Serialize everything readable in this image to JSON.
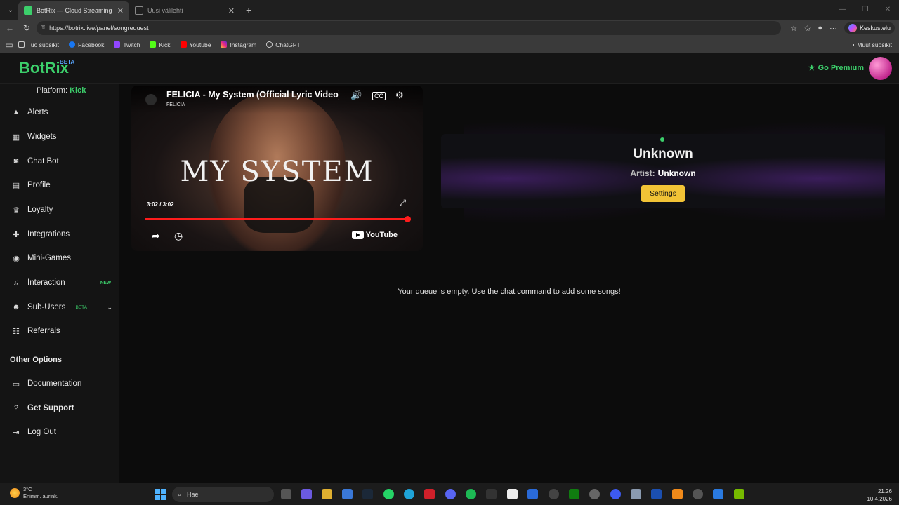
{
  "browser": {
    "tabs": [
      {
        "title": "BotRix — Cloud Streaming Bot for",
        "active": true
      },
      {
        "title": "Uusi välilehti",
        "active": false
      }
    ],
    "url": "https://botrix.live/panel/songrequest",
    "copilot_label": "Keskustelu",
    "bookmarks": [
      "Tuo suosikit",
      "Facebook",
      "Twitch",
      "Kick",
      "Youtube",
      "Instagram",
      "ChatGPT"
    ],
    "other_favorites": "Muut suosikit"
  },
  "header": {
    "logo": "BotRix",
    "logo_badge": "BETA",
    "premium_label": "Go Premium"
  },
  "sidebar": {
    "platform_label": "Platform:",
    "platform_value": "Kick",
    "items": [
      {
        "label": "Alerts",
        "icon": "warning-icon"
      },
      {
        "label": "Widgets",
        "icon": "grid-icon"
      },
      {
        "label": "Chat Bot",
        "icon": "robot-icon"
      },
      {
        "label": "Profile",
        "icon": "profile-icon"
      },
      {
        "label": "Loyalty",
        "icon": "trophy-icon"
      },
      {
        "label": "Integrations",
        "icon": "puzzle-icon"
      },
      {
        "label": "Mini-Games",
        "icon": "gamepad-icon"
      },
      {
        "label": "Interaction",
        "icon": "music-icon",
        "badge": "NEW"
      },
      {
        "label": "Sub-Users",
        "icon": "users-icon",
        "badge": "BETA"
      },
      {
        "label": "Referrals",
        "icon": "referral-icon"
      }
    ],
    "other_title": "Other Options",
    "other_items": [
      {
        "label": "Documentation",
        "icon": "doc-icon"
      },
      {
        "label": "Get Support",
        "icon": "help-icon"
      },
      {
        "label": "Log Out",
        "icon": "logout-icon"
      }
    ]
  },
  "player": {
    "title": "FELICIA - My System (Official Lyric Video)",
    "channel": "FELICIA",
    "overlay_text": "MY SYSTEM",
    "time": "3:02 / 3:02",
    "progress": 1.0,
    "brand": "YouTube"
  },
  "now_playing": {
    "title": "Unknown",
    "artist_label": "Artist:",
    "artist": "Unknown",
    "settings_label": "Settings"
  },
  "queue": {
    "empty_message": "Your queue is empty. Use the chat command to add some songs!"
  },
  "taskbar": {
    "temperature": "3°C",
    "weather": "Enimm. aurink.",
    "search_placeholder": "Hae",
    "time": "21.26",
    "date": "10.4.2026"
  }
}
